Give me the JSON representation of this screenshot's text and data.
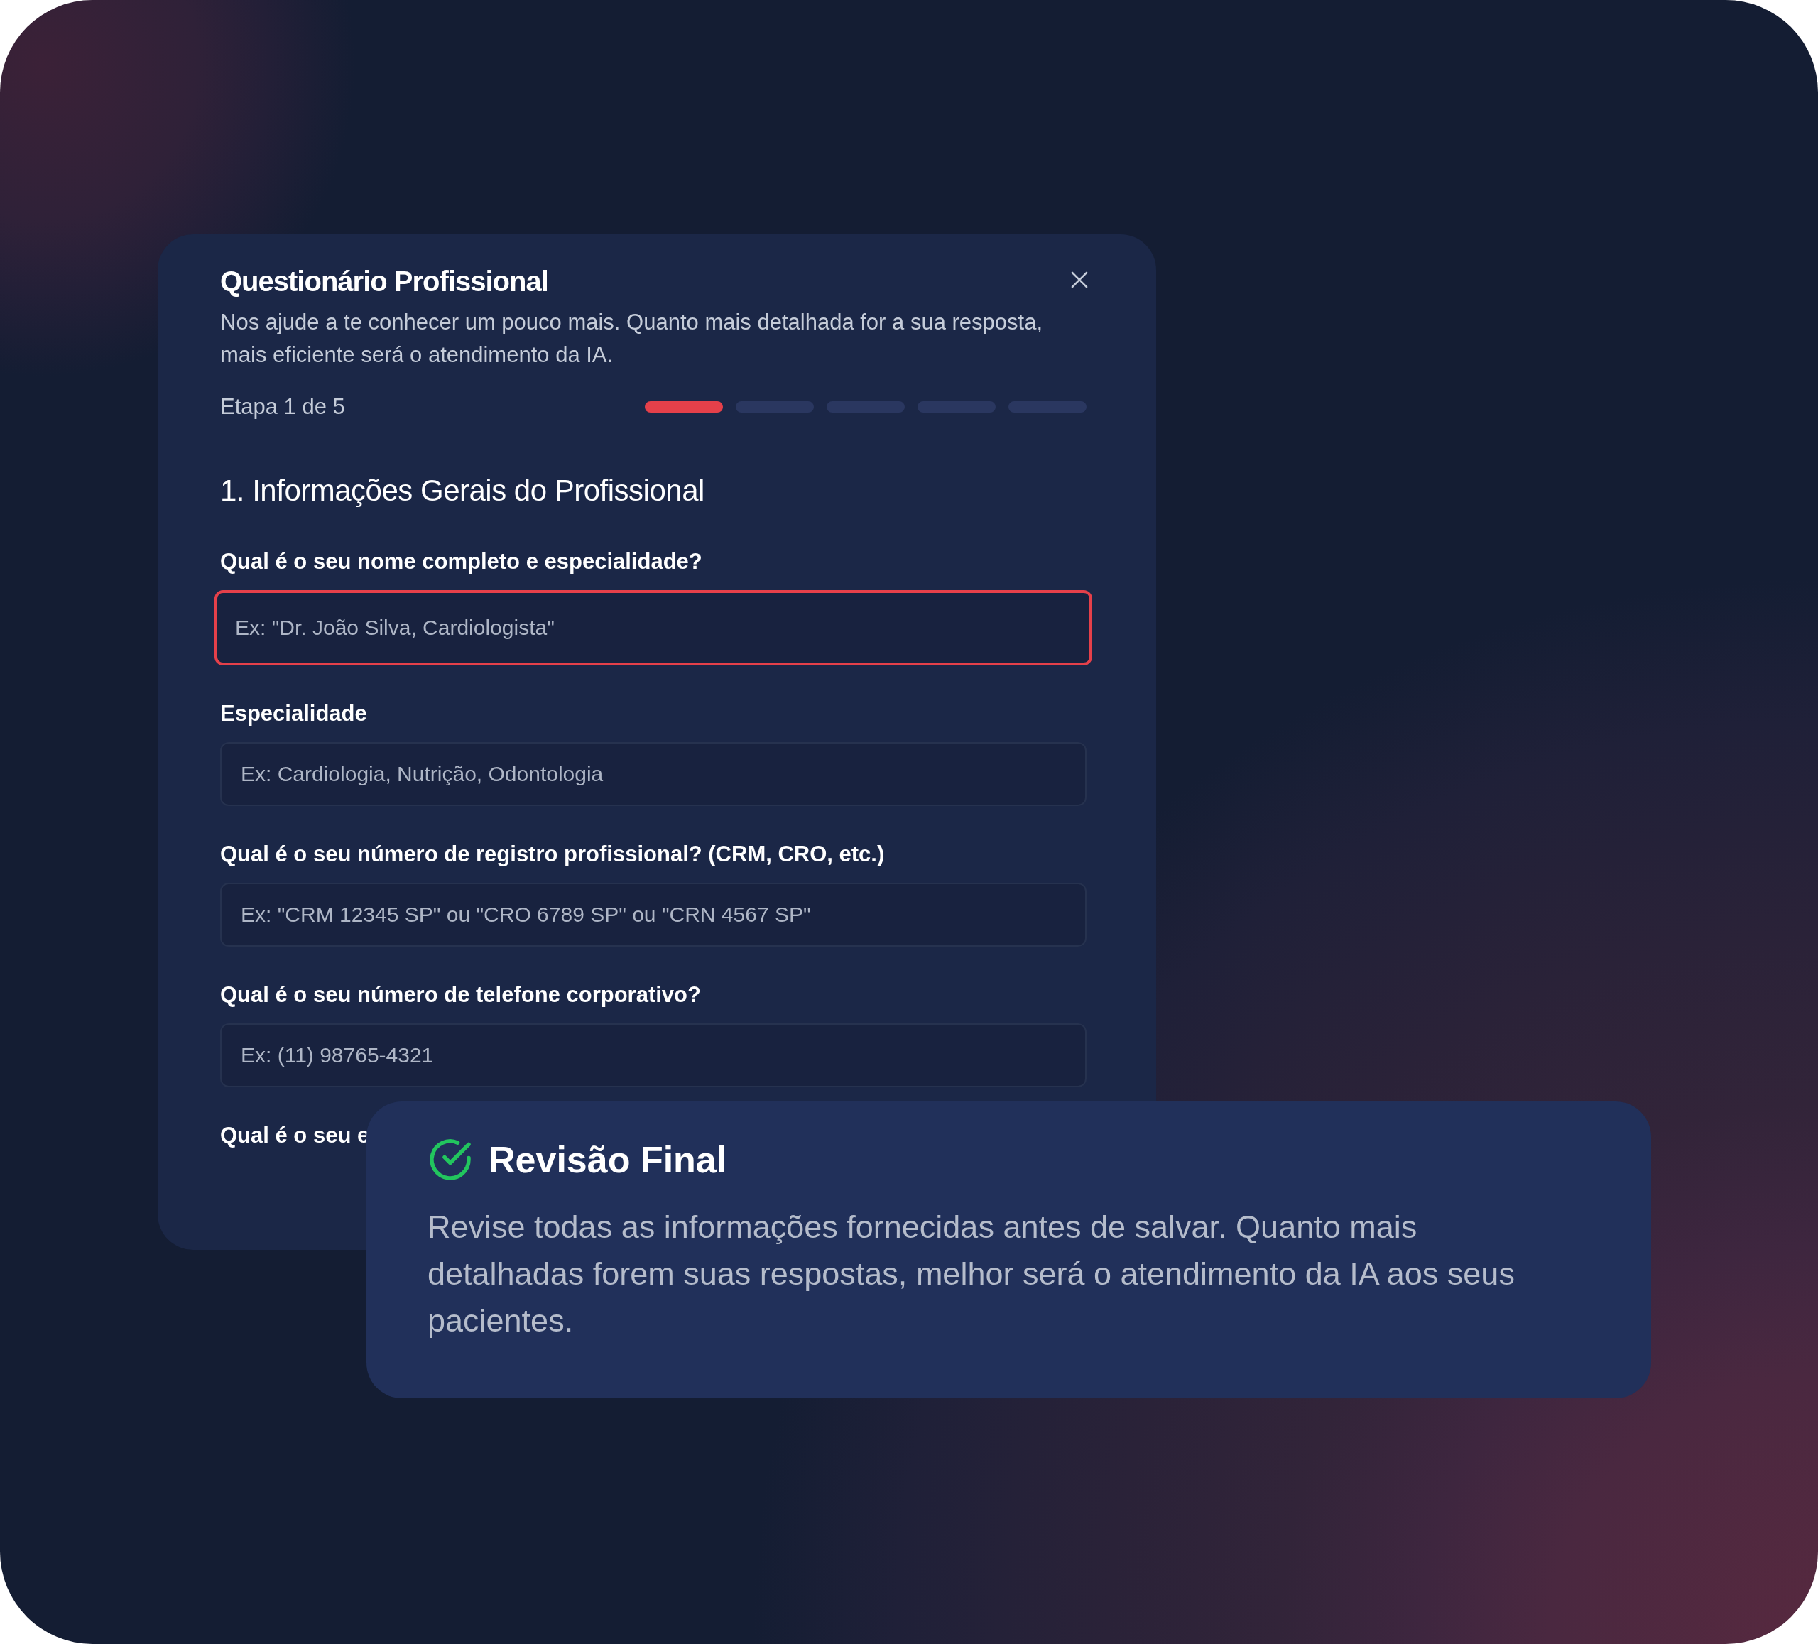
{
  "modal": {
    "title": "Questionário Profissional",
    "description": "Nos ajude a te conhecer um pouco mais. Quanto mais detalhada for a sua resposta, mais eficiente será o atendimento da IA.",
    "progress": {
      "label": "Etapa 1 de 5",
      "steps": [
        {
          "active": true
        },
        {
          "active": false
        },
        {
          "active": false
        },
        {
          "active": false
        },
        {
          "active": false
        }
      ]
    },
    "section_title": "1. Informações Gerais do Profissional",
    "fields": [
      {
        "label": "Qual é o seu nome completo e especialidade?",
        "placeholder": "Ex: \"Dr. João Silva, Cardiologista\"",
        "focused": true
      },
      {
        "label": "Especialidade",
        "placeholder": "Ex: Cardiologia, Nutrição, Odontologia",
        "focused": false
      },
      {
        "label": "Qual é o seu número de registro profissional? (CRM, CRO, etc.)",
        "placeholder": "Ex: \"CRM 12345 SP\" ou \"CRO 6789 SP\" ou \"CRN 4567 SP\"",
        "focused": false
      },
      {
        "label": "Qual é o seu número de telefone corporativo?",
        "placeholder": "Ex: (11) 98765-4321",
        "focused": false
      }
    ],
    "next_label": "Qual é o seu e"
  },
  "review_card": {
    "title": "Revisão Final",
    "text": "Revise todas as informações fornecidas antes de salvar. Quanto mais detalhadas forem suas respostas, melhor será o atendimento da IA aos seus pacientes."
  }
}
